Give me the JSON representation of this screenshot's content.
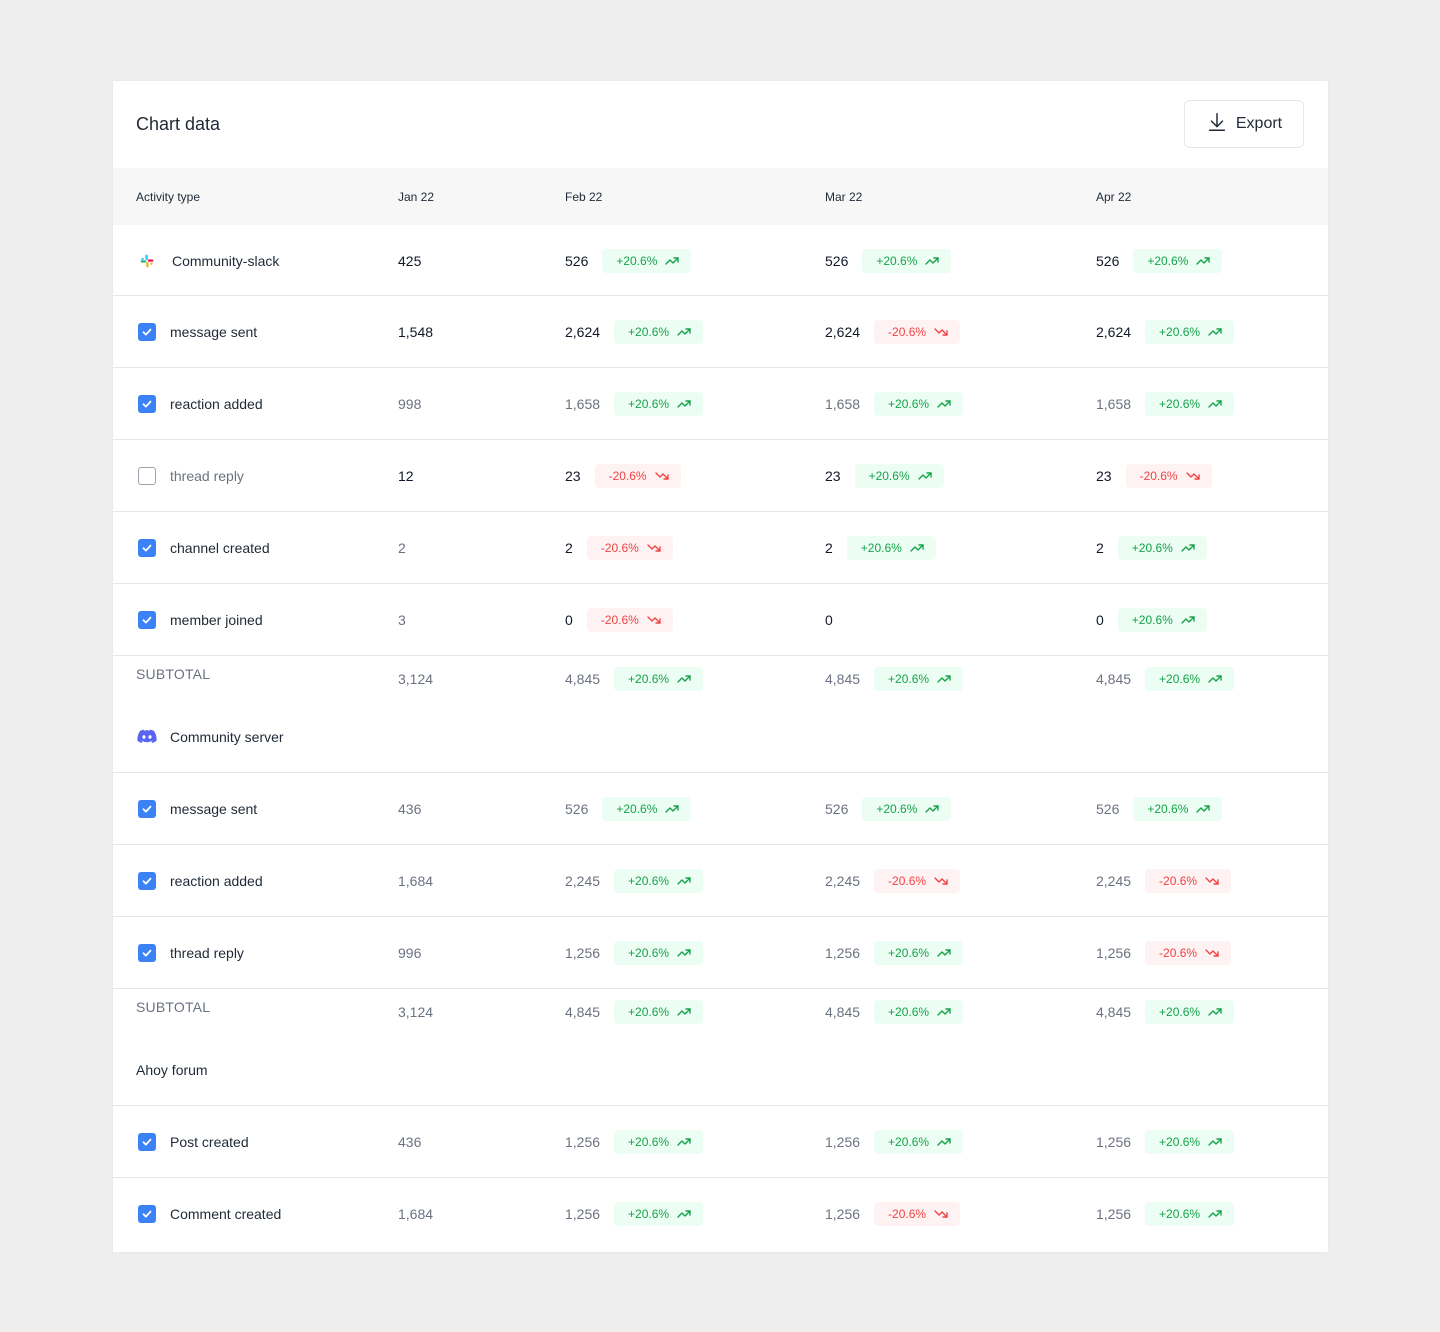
{
  "title": "Chart data",
  "export_label": "Export",
  "columns": [
    "Activity type",
    "Jan 22",
    "Feb 22",
    "Mar 22",
    "Apr 22"
  ],
  "colors": {
    "checkbox": "#3b82f6",
    "positive": "#16a34a",
    "negative": "#ef4444",
    "discord": "#5865f2"
  },
  "groups": [
    {
      "name": "Community-slack",
      "icon": "slack-icon",
      "rows": [
        {
          "label": "message sent",
          "checked": true,
          "jan": "1,548",
          "feb": "2,624",
          "feb_b": "+20.6%",
          "feb_d": "up",
          "mar": "2,624",
          "mar_b": "-20.6%",
          "mar_d": "down",
          "apr": "2,624",
          "apr_b": "+20.6%",
          "apr_d": "up"
        },
        {
          "label": "reaction added",
          "checked": true,
          "jan": "998",
          "feb": "1,658",
          "feb_b": "+20.6%",
          "feb_d": "up",
          "mar": "1,658",
          "mar_b": "+20.6%",
          "mar_d": "up",
          "apr": "1,658",
          "apr_b": "+20.6%",
          "apr_d": "up"
        },
        {
          "label": "thread reply",
          "checked": false,
          "jan": "12",
          "feb": "23",
          "feb_b": "-20.6%",
          "feb_d": "down",
          "mar": "23",
          "mar_b": "+20.6%",
          "mar_d": "up",
          "apr": "23",
          "apr_b": "-20.6%",
          "apr_d": "down"
        },
        {
          "label": "channel created",
          "checked": true,
          "jan": "2",
          "feb": "2",
          "feb_b": "-20.6%",
          "feb_d": "down",
          "mar": "2",
          "mar_b": "+20.6%",
          "mar_d": "up",
          "apr": "2",
          "apr_b": "+20.6%",
          "apr_d": "up"
        },
        {
          "label": "member joined",
          "checked": true,
          "jan": "3",
          "feb": "0",
          "feb_b": "-20.6%",
          "feb_d": "down",
          "mar": "0",
          "mar_b": "",
          "mar_d": "",
          "apr": "0",
          "apr_b": "+20.6%",
          "apr_d": "up"
        }
      ],
      "header_values": {
        "jan": "425",
        "feb": "526",
        "feb_b": "+20.6%",
        "mar": "526",
        "mar_b": "+20.6%",
        "apr": "526",
        "apr_b": "+20.6%"
      },
      "subtotal": {
        "label": "SUBTOTAL",
        "jan": "3,124",
        "feb": "4,845",
        "feb_b": "+20.6%",
        "mar": "4,845",
        "mar_b": "+20.6%",
        "apr": "4,845",
        "apr_b": "+20.6%"
      }
    },
    {
      "name": "Community server",
      "icon": "discord-icon",
      "rows": [
        {
          "label": "message sent",
          "checked": true,
          "jan": "436",
          "feb": "526",
          "feb_b": "+20.6%",
          "feb_d": "up",
          "mar": "526",
          "mar_b": "+20.6%",
          "mar_d": "up",
          "apr": "526",
          "apr_b": "+20.6%",
          "apr_d": "up"
        },
        {
          "label": "reaction added",
          "checked": true,
          "jan": "1,684",
          "feb": "2,245",
          "feb_b": "+20.6%",
          "feb_d": "up",
          "mar": "2,245",
          "mar_b": "-20.6%",
          "mar_d": "down",
          "apr": "2,245",
          "apr_b": "-20.6%",
          "apr_d": "down"
        },
        {
          "label": "thread reply",
          "checked": true,
          "jan": "996",
          "feb": "1,256",
          "feb_b": "+20.6%",
          "feb_d": "up",
          "mar": "1,256",
          "mar_b": "+20.6%",
          "mar_d": "up",
          "apr": "1,256",
          "apr_b": "-20.6%",
          "apr_d": "down"
        }
      ],
      "subtotal": {
        "label": "SUBTOTAL",
        "jan": "3,124",
        "feb": "4,845",
        "feb_b": "+20.6%",
        "mar": "4,845",
        "mar_b": "+20.6%",
        "apr": "4,845",
        "apr_b": "+20.6%"
      }
    },
    {
      "name": "Ahoy forum",
      "icon": "",
      "rows": [
        {
          "label": "Post created",
          "checked": true,
          "jan": "436",
          "feb": "1,256",
          "feb_b": "+20.6%",
          "feb_d": "up",
          "mar": "1,256",
          "mar_b": "+20.6%",
          "mar_d": "up",
          "apr": "1,256",
          "apr_b": "+20.6%",
          "apr_d": "up"
        },
        {
          "label": "Comment created",
          "checked": true,
          "jan": "1,684",
          "feb": "1,256",
          "feb_b": "+20.6%",
          "feb_d": "up",
          "mar": "1,256",
          "mar_b": "-20.6%",
          "mar_d": "down",
          "apr": "1,256",
          "apr_b": "+20.6%",
          "apr_d": "up"
        }
      ]
    }
  ]
}
